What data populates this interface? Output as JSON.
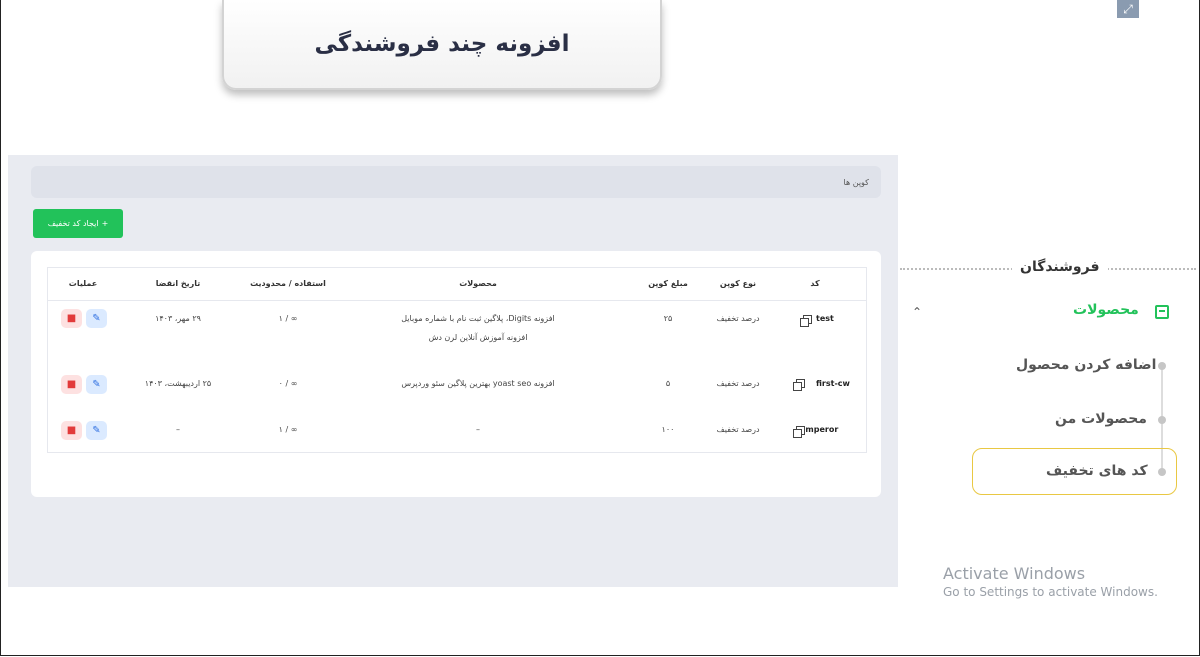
{
  "banner_title": "افزونه چند فروشندگی",
  "breadcrumb": "کوپن ها",
  "create_button": "ایجاد کد تخفیف",
  "columns": {
    "code": "کد",
    "type": "نوع کوپن",
    "amount": "مبلغ کوپن",
    "products": "محصولات",
    "usage": "استفاده / محدودیت",
    "expiry": "تاریخ انقضا",
    "actions": "عملیات"
  },
  "coupons": [
    {
      "code": "test",
      "type": "درصد تخفیف",
      "amount": "۲۵",
      "products_line1": "افزونه Digits، پلاگین ثبت نام با شماره موبایل",
      "products_line2": "افزونه آموزش آنلاین لرن دش",
      "usage": "∞ / ۱",
      "expiry": "۲۹ مهر، ۱۴۰۳"
    },
    {
      "code": "first-cw",
      "type": "درصد تخفیف",
      "amount": "۵",
      "products_line1": "افزونه yoast seo بهترین پلاگین سئو وردپرس",
      "products_line2": "",
      "usage": "∞ / ۰",
      "expiry": "۲۵ اردیبهشت، ۱۴۰۳"
    },
    {
      "code": "emperor",
      "type": "درصد تخفیف",
      "amount": "۱۰۰",
      "products_line1": "–",
      "products_line2": "",
      "usage": "∞ / ۱",
      "expiry": "–"
    }
  ],
  "sidebar": {
    "heading": "فروشندگان",
    "products": "محصولات",
    "add_product": "اضافه کردن محصول",
    "my_products": "محصولات من",
    "discount_codes": "کد های تخفیف"
  },
  "watermark": {
    "line1": "Activate Windows",
    "line2": "Go to Settings to activate Windows."
  },
  "colors": {
    "accent": "#22c25a",
    "highlight": "#e9c843",
    "edit": "#2f6fe0",
    "delete": "#e23b3b"
  },
  "icons": [
    "expand-icon",
    "plus-icon",
    "copy-icon",
    "edit-icon",
    "delete-icon",
    "box-icon",
    "chevron-up-icon"
  ]
}
